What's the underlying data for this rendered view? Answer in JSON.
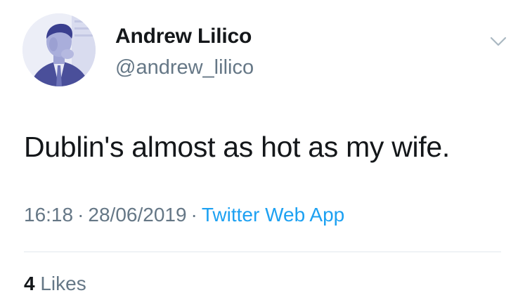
{
  "tweet": {
    "author": {
      "display_name": "Andrew Lilico",
      "handle": "@andrew_lilico",
      "avatar_icon": "profile-photo"
    },
    "more_icon": "chevron-down-icon",
    "text": "Dublin's almost as hot as my wife.",
    "meta": {
      "time": "16:18",
      "separator": "·",
      "date": "28/06/2019",
      "source": "Twitter Web App"
    },
    "engagement": {
      "likes_count": "4",
      "likes_label": "Likes"
    }
  },
  "colors": {
    "text_primary": "#14171a",
    "text_secondary": "#657786",
    "link": "#1da1f2",
    "divider": "#e1e8ed",
    "avatar_tint": "#3a3f8f"
  }
}
